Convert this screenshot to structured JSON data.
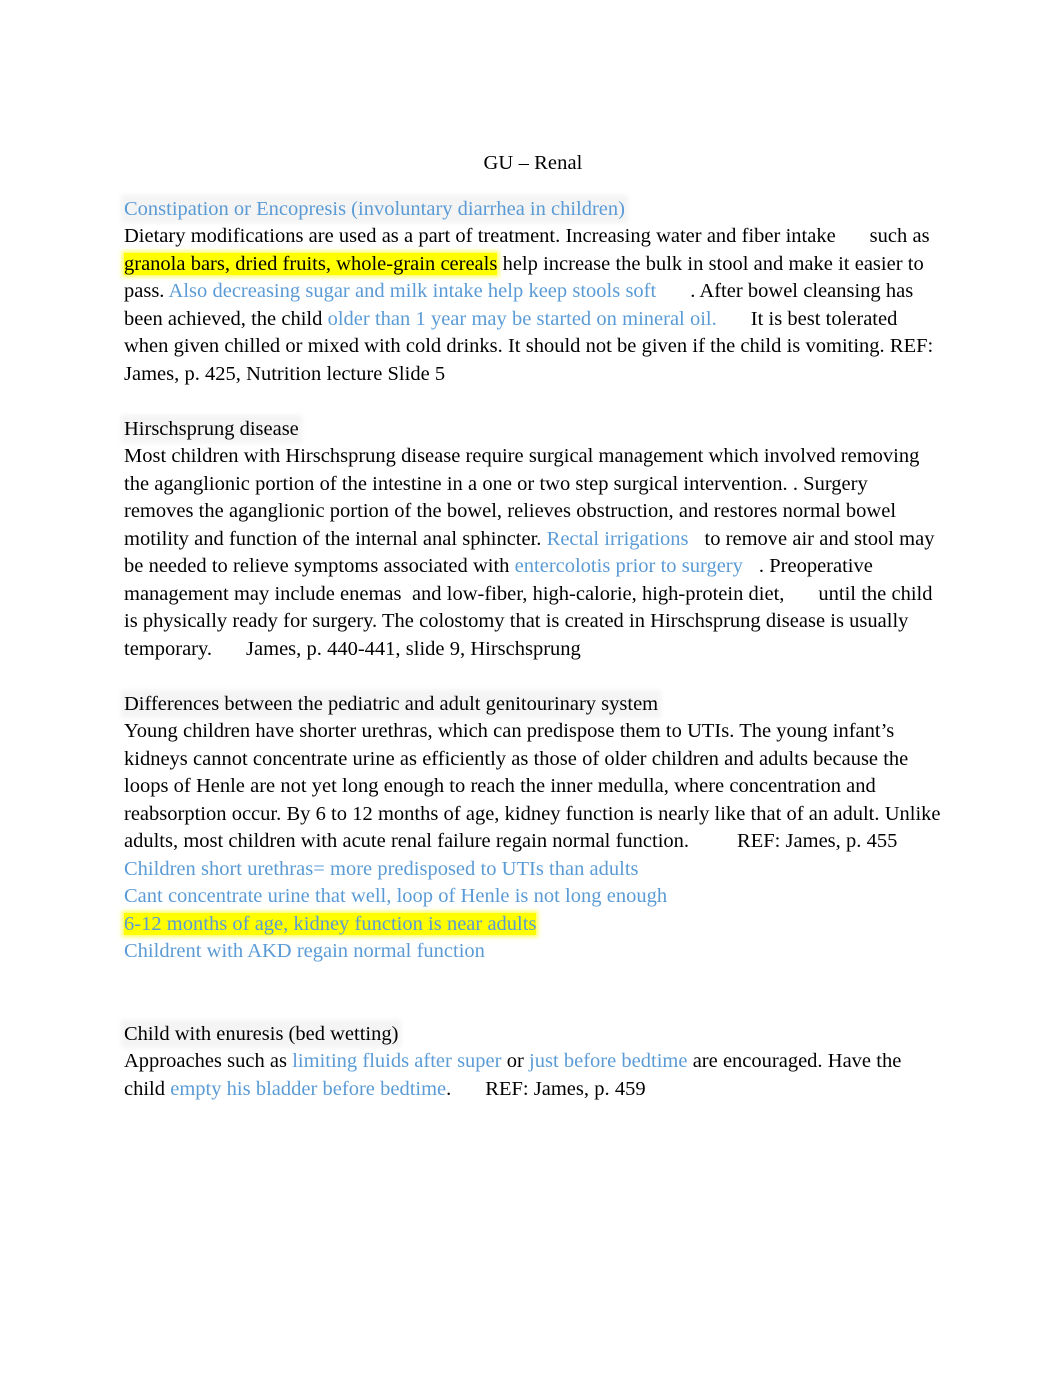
{
  "document": {
    "title": "GU – Renal",
    "colors": {
      "blue_text": "#5B9BD5",
      "yellow_highlight": "#FFFF00",
      "white_highlight": "#F4F4F4",
      "body_text": "#000000",
      "page_background": "#FFFFFF"
    }
  },
  "sections": [
    {
      "id": "constipation",
      "heading": "Constipation or Encopresis (involuntary diarrhea in children)",
      "heading_style": "blue",
      "runs": {
        "r1": "Dietary modifications are used as a part of treatment. Increasing water and fiber intake",
        "r2": "such as",
        "r3": "granola bars, dried fruits, whole-grain cereals",
        "r4": " help increase the bulk in stool and make it easier to pass. ",
        "r5": "Also decreasing sugar and milk intake help keep stools soft",
        "r6": ". After bowel cleansing has been achieved, the child ",
        "r7": "older than 1 year may be started on mineral oil.",
        "r8": "It is best tolerated when given chilled or mixed with cold drinks. It should not be given if the child is vomiting.",
        "r9": "REF: James, p. 425, Nutrition lecture Slide 5"
      }
    },
    {
      "id": "hirschsprung",
      "heading": "Hirschsprung disease",
      "heading_style": "black",
      "runs": {
        "r1": "Most children with Hirschsprung disease require surgical management which involved removing the aganglionic portion of the intestine in a one or two step surgical intervention. . Surgery removes the aganglionic portion of the bowel, relieves obstruction, and restores normal bowel motility and function of the internal anal sphincter. ",
        "r2": "Rectal irrigations",
        "r3": "to remove air and stool may be needed to relieve symptoms associated with ",
        "r4": "entercolotis prior to surgery",
        "r5": ". Preoperative management may include enemas  and low-fiber, high-calorie, high-protein diet,",
        "r6": "until the child is physically ready for surgery. The colostomy that is created in Hirschsprung disease is usually temporary.",
        "r7": "James, p. 440-441, slide 9, Hirschsprung"
      }
    },
    {
      "id": "gu-differences",
      "heading": "Differences between the pediatric and adult genitourinary system",
      "heading_style": "black",
      "runs": {
        "r1": "Young children have shorter urethras, which can predispose them to UTIs. The young infant’s kidneys cannot concentrate urine as efficiently as those of older children and adults because the loops of Henle are not yet long enough to reach the inner medulla, where concentration and reabsorption occur. By 6 to 12 months of age, kidney function is nearly like that of an adult. Unlike adults, most children with acute renal failure regain normal function.",
        "r2": "REF: James, p. 455"
      },
      "notes": [
        {
          "text": "Children short urethras= more predisposed to UTIs than adults",
          "style": "blue"
        },
        {
          "text": "Cant concentrate urine that well, loop of Henle is not long enough",
          "style": "blue"
        },
        {
          "text": "6-12 months of age, kidney function is near adults",
          "style": "blue-highlighted"
        },
        {
          "text": "Childrent with AKD regain normal function",
          "style": "blue"
        }
      ]
    },
    {
      "id": "enuresis",
      "heading": "Child with enuresis (bed wetting)",
      "heading_style": "black",
      "runs": {
        "r1": "Approaches such as ",
        "r2": "limiting fluids after super",
        "r3": " or ",
        "r4": "just before bedtime",
        "r5": " are encouraged. Have the child ",
        "r6": "empty his bladder before bedtime",
        "r7": ".",
        "r8": "REF: James, p. 459"
      }
    }
  ]
}
